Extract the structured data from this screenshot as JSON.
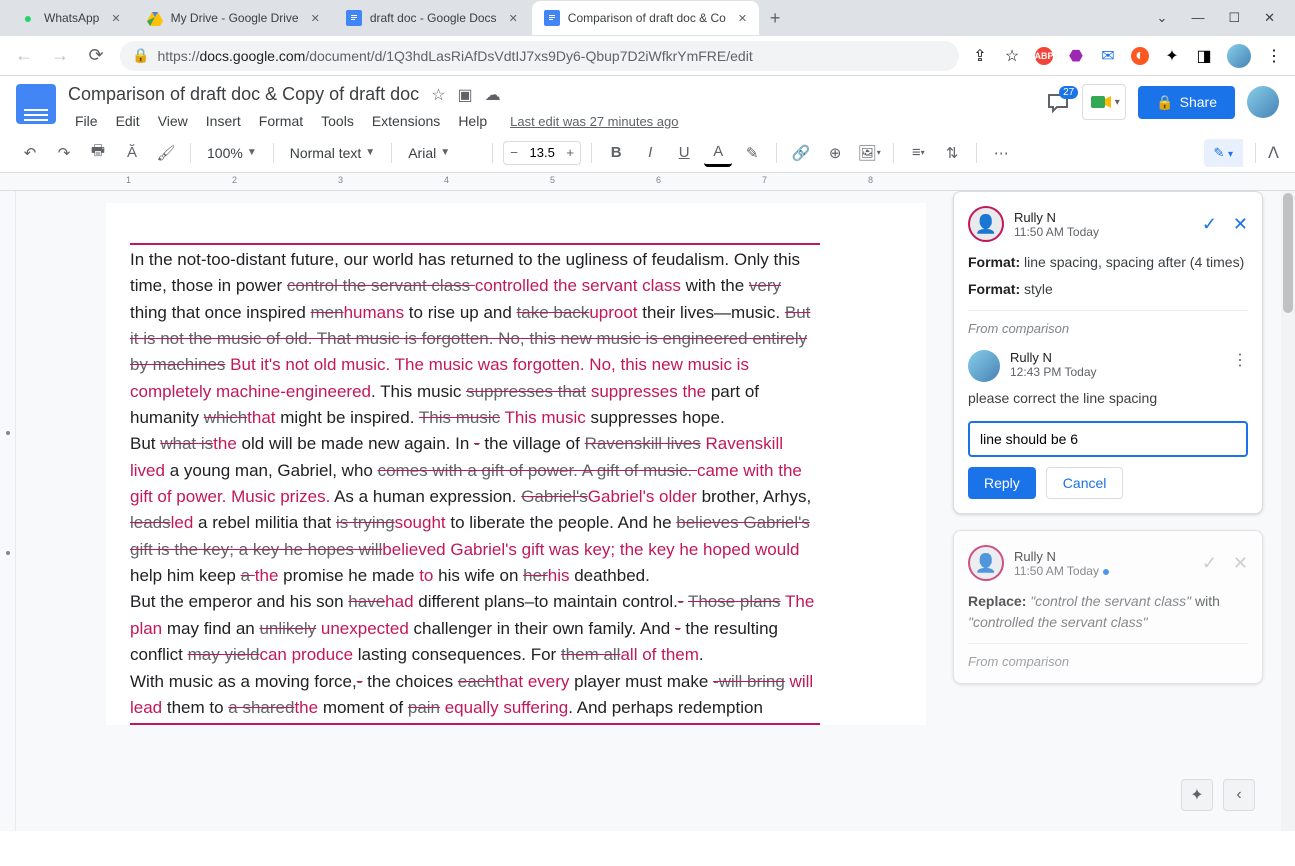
{
  "browser": {
    "tabs": [
      {
        "title": "WhatsApp",
        "active": false,
        "favicon": "whatsapp"
      },
      {
        "title": "My Drive - Google Drive",
        "active": false,
        "favicon": "drive"
      },
      {
        "title": "draft doc - Google Docs",
        "active": false,
        "favicon": "docs"
      },
      {
        "title": "Comparison of draft doc & Co",
        "active": true,
        "favicon": "docs"
      }
    ],
    "url_prefix": "https://",
    "url_host": "docs.google.com",
    "url_path": "/document/d/1Q3hdLasRiAfDsVdtIJ7xs9Dy6-Qbup7D2iWfkrYmFRE/edit"
  },
  "doc": {
    "title": "Comparison of draft doc & Copy of draft doc",
    "menus": [
      "File",
      "Edit",
      "View",
      "Insert",
      "Format",
      "Tools",
      "Extensions",
      "Help"
    ],
    "last_edit": "Last edit was 27 minutes ago",
    "comment_count": "27",
    "share_label": "Share",
    "zoom": "100%",
    "style": "Normal text",
    "font": "Arial",
    "font_size": "13.5"
  },
  "text_runs": [
    {
      "t": "In the not-too-distant future, our world has returned to the ugliness of feudalism. Only this time, those in power ",
      "c": "n"
    },
    {
      "t": "control the servant class ",
      "c": "d"
    },
    {
      "t": "controlled the  servant class ",
      "c": "i"
    },
    {
      "t": " with the ",
      "c": "n"
    },
    {
      "t": "very ",
      "c": "d"
    },
    {
      "t": "thing that once inspired ",
      "c": "n"
    },
    {
      "t": "men",
      "c": "d"
    },
    {
      "t": "humans",
      "c": "i"
    },
    {
      "t": " to rise up and ",
      "c": "n"
    },
    {
      "t": "take back",
      "c": "d"
    },
    {
      "t": "uproot",
      "c": "i"
    },
    {
      "t": " their lives—music. ",
      "c": "n"
    },
    {
      "t": "But it is not the music of old. That music is forgotten. No, this new music is engineered entirely by machines",
      "c": "d"
    },
    {
      "t": "  But it's not old  music.  The music was forgotten.  No,  this  new music is completely machine-engineered",
      "c": "i"
    },
    {
      "t": ". This music ",
      "c": "n"
    },
    {
      "t": "suppresses that",
      "c": "d"
    },
    {
      "t": "  suppresses the",
      "c": "i"
    },
    {
      "t": " part of humanity ",
      "c": "n"
    },
    {
      "t": "which",
      "c": "d"
    },
    {
      "t": "that",
      "c": "i"
    },
    {
      "t": " might be inspired. ",
      "c": "n"
    },
    {
      "t": "This music",
      "c": "d"
    },
    {
      "t": "  This music",
      "c": "i"
    },
    {
      "t": " suppresses hope.",
      "c": "n"
    },
    {
      "t": "\nBut ",
      "c": "n"
    },
    {
      "t": "what is",
      "c": "d"
    },
    {
      "t": "the",
      "c": "i"
    },
    {
      "t": " old will be made new again. In ",
      "c": "n"
    },
    {
      "t": "-",
      "c": "d"
    },
    {
      "t": " the village of ",
      "c": "n"
    },
    {
      "t": "Ravenskill lives",
      "c": "d"
    },
    {
      "t": " Ravenskill lived",
      "c": "i"
    },
    {
      "t": " a young man, Gabriel, who ",
      "c": "n"
    },
    {
      "t": "comes with a gift of power. A gift of music. ",
      "c": "d"
    },
    {
      "t": "came with the  gift of power.  Music prizes.",
      "c": "i"
    },
    {
      "t": "  As a human expression. ",
      "c": "n"
    },
    {
      "t": "Gabriel's",
      "c": "d"
    },
    {
      "t": "Gabriel's  older",
      "c": "i"
    },
    {
      "t": " brother, Arhys, ",
      "c": "n"
    },
    {
      "t": "leads",
      "c": "d"
    },
    {
      "t": "led",
      "c": "i"
    },
    {
      "t": " a rebel militia that ",
      "c": "n"
    },
    {
      "t": "is trying",
      "c": "d"
    },
    {
      "t": "sought",
      "c": "i"
    },
    {
      "t": " to liberate the people. And he ",
      "c": "n"
    },
    {
      "t": "believes Gabriel's gift is the key; a key he hopes will",
      "c": "d"
    },
    {
      "t": "believed Gabriel's  gift was key;  the key he  hoped would",
      "c": "i"
    },
    {
      "t": " help him keep ",
      "c": "n"
    },
    {
      "t": "a ",
      "c": "d"
    },
    {
      "t": "the ",
      "c": "i"
    },
    {
      "t": " promise he made ",
      "c": "n"
    },
    {
      "t": "to",
      "c": "i"
    },
    {
      "t": " his wife on ",
      "c": "n"
    },
    {
      "t": "her",
      "c": "d"
    },
    {
      "t": "his",
      "c": "i"
    },
    {
      "t": " deathbed.",
      "c": "n"
    },
    {
      "t": "\nBut the emperor and his son ",
      "c": "n"
    },
    {
      "t": "have",
      "c": "d"
    },
    {
      "t": "had",
      "c": "i"
    },
    {
      "t": " different plans–to maintain control.",
      "c": "n"
    },
    {
      "t": "-",
      "c": "d"
    },
    {
      "t": " ",
      "c": "n"
    },
    {
      "t": "Those plans",
      "c": "d"
    },
    {
      "t": "  The plan",
      "c": "i"
    },
    {
      "t": " may find an ",
      "c": "n"
    },
    {
      "t": "unlikely",
      "c": "d"
    },
    {
      "t": "  unexpected",
      "c": "i"
    },
    {
      "t": " challenger in their own family. And ",
      "c": "n"
    },
    {
      "t": "-",
      "c": "d"
    },
    {
      "t": " the resulting conflict ",
      "c": "n"
    },
    {
      "t": "may yield",
      "c": "d"
    },
    {
      "t": "can produce",
      "c": "i"
    },
    {
      "t": " lasting consequences. For ",
      "c": "n"
    },
    {
      "t": "them all",
      "c": "d"
    },
    {
      "t": "all of them",
      "c": "i"
    },
    {
      "t": ".",
      "c": "n"
    },
    {
      "t": "\nWith music as a moving force,",
      "c": "n"
    },
    {
      "t": "-",
      "c": "d"
    },
    {
      "t": "  the choices ",
      "c": "n"
    },
    {
      "t": "each",
      "c": "d"
    },
    {
      "t": "that  every",
      "c": "i"
    },
    {
      "t": " player must make ",
      "c": "n"
    },
    {
      "t": "-",
      "c": "d"
    },
    {
      "t": "will bring",
      "c": "d"
    },
    {
      "t": "  will lead",
      "c": "i"
    },
    {
      "t": " them to ",
      "c": "n"
    },
    {
      "t": "a shared",
      "c": "d"
    },
    {
      "t": "the",
      "c": "i"
    },
    {
      "t": " moment of ",
      "c": "n"
    },
    {
      "t": "pain",
      "c": "d"
    },
    {
      "t": "  equally suffering",
      "c": "i"
    },
    {
      "t": ". And perhaps redemption",
      "c": "n"
    }
  ],
  "comments": {
    "c1": {
      "user": "Rully N",
      "time": "11:50 AM Today",
      "line1_label": "Format:",
      "line1_text": " line spacing, spacing after (4 times)",
      "line2_label": "Format:",
      "line2_text": " style",
      "from": "From comparison",
      "reply_user": "Rully N",
      "reply_time": "12:43 PM Today",
      "reply_text": "please correct the line spacing",
      "input_value": "line should be 6",
      "reply_btn": "Reply",
      "cancel_btn": "Cancel"
    },
    "c2": {
      "user": "Rully N",
      "time": "11:50 AM Today",
      "label": "Replace:",
      "quote1": "\"control the servant class\"",
      "with": " with ",
      "quote2": "\"controlled the servant class\"",
      "from": "From comparison"
    }
  }
}
